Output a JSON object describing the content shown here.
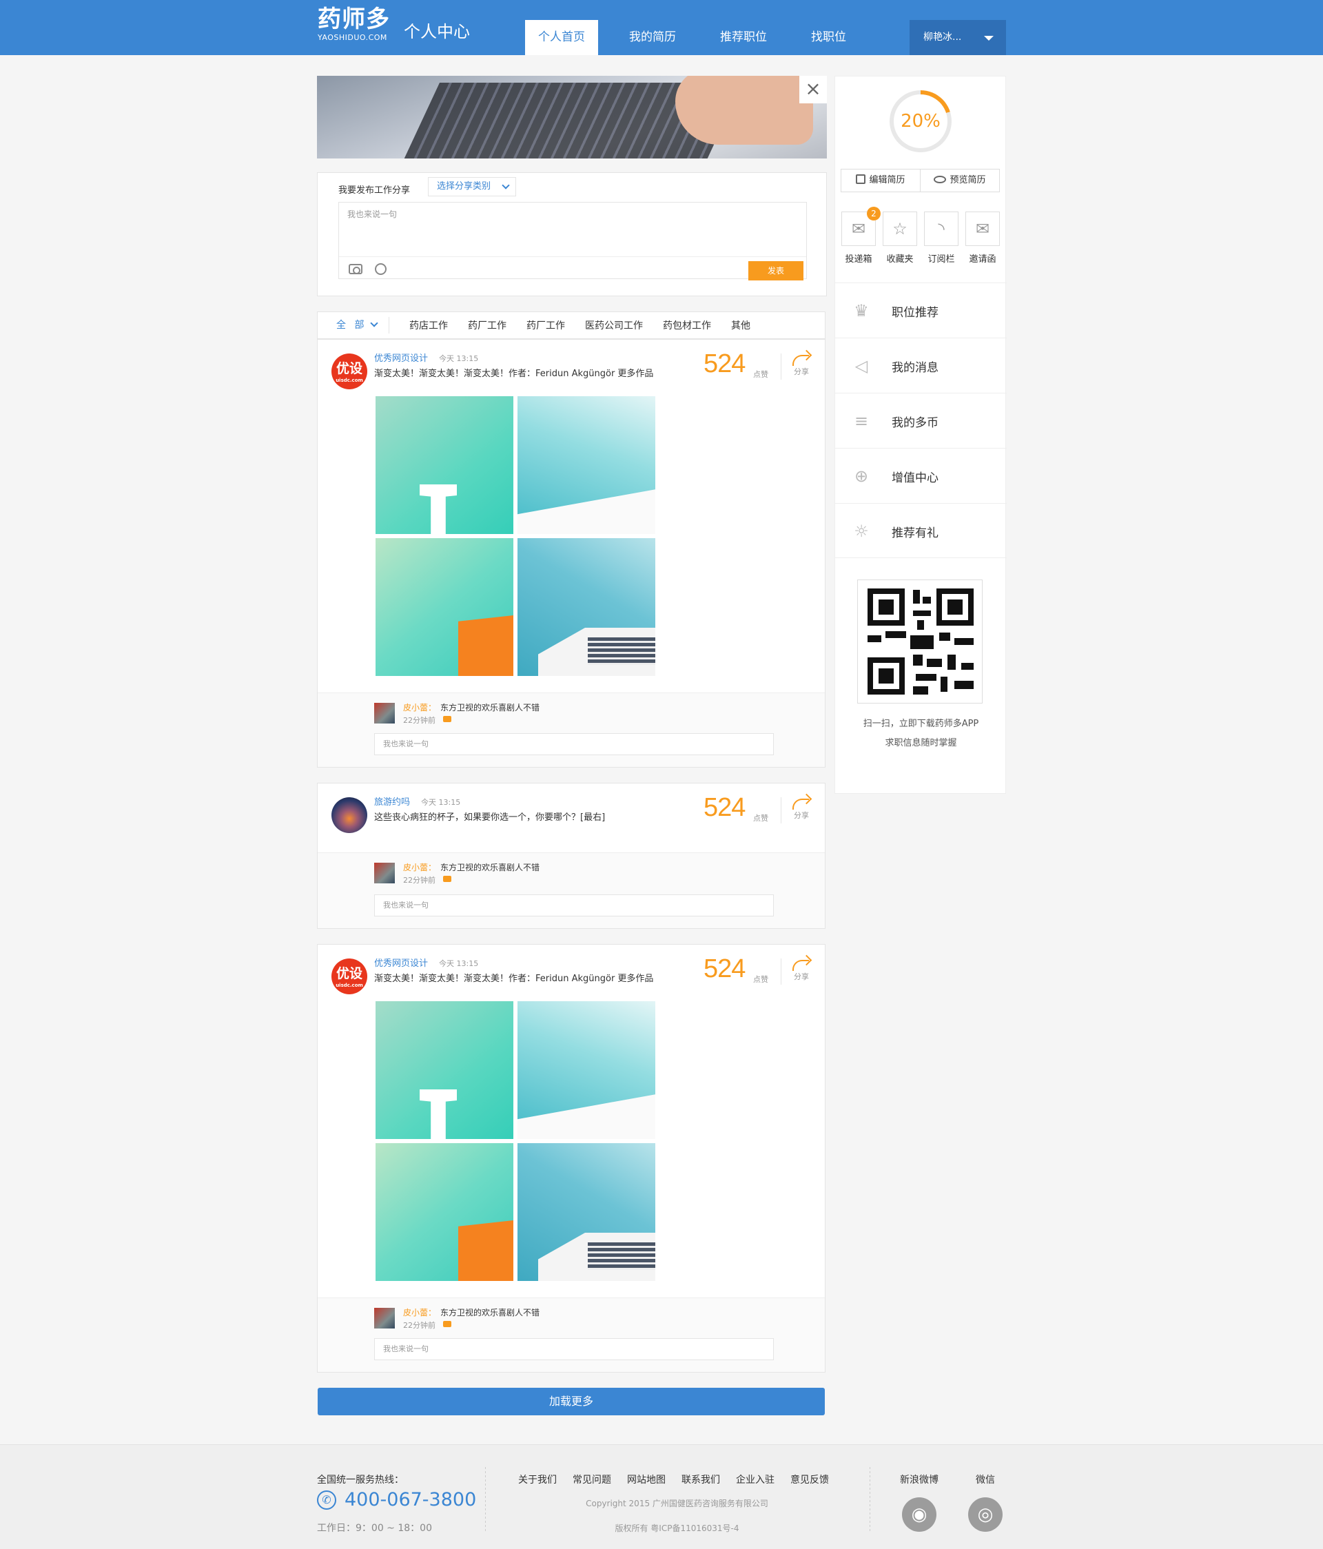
{
  "header": {
    "logo_main": "药师多",
    "logo_sub": "YAOSHIDUO.COM",
    "page_title": "个人中心",
    "nav": [
      "个人首页",
      "我的简历",
      "推荐职位",
      "找职位"
    ],
    "user": "柳艳冰..."
  },
  "publish": {
    "label": "我要发布工作分享",
    "category": "选择分享类别",
    "placeholder": "我也来说一句",
    "send": "发表"
  },
  "filter": {
    "all": "全 部",
    "categories": [
      "药店工作",
      "药厂工作",
      "药厂工作",
      "医药公司工作",
      "药包材工作",
      "其他"
    ]
  },
  "posts": [
    {
      "avatar": "优设",
      "avatar_sub": "uisdc.com",
      "user": "优秀网页设计",
      "time": "今天 13:15",
      "text": "渐变太美！渐变太美！渐变太美！作者：Feridun Akgüngör 更多作品",
      "likes": "524",
      "like_label": "点赞",
      "share": "分享"
    },
    {
      "user": "旅游约吗",
      "time": "今天 13:15",
      "text": "这些丧心病狂的杯子，如果要你选一个，你要哪个？[最右]",
      "likes": "524",
      "like_label": "点赞",
      "share": "分享"
    },
    {
      "avatar": "优设",
      "avatar_sub": "uisdc.com",
      "user": "优秀网页设计",
      "time": "今天 13:15",
      "text": "渐变太美！渐变太美！渐变太美！作者：Feridun Akgüngör 更多作品",
      "likes": "524",
      "like_label": "点赞",
      "share": "分享"
    }
  ],
  "comment": {
    "user": "皮小蕾：",
    "text": "东方卫视的欢乐喜剧人不错",
    "time": "22分钟前",
    "placeholder": "我也来说一句"
  },
  "load_more": "加载更多",
  "sidebar": {
    "progress": "20%",
    "edit": "编辑简历",
    "preview": "预览简历",
    "quick": [
      {
        "label": "投递箱",
        "badge": "2",
        "icon": "inbox-icon"
      },
      {
        "label": "收藏夹",
        "icon": "star-icon"
      },
      {
        "label": "订阅栏",
        "icon": "rss-icon"
      },
      {
        "label": "邀请函",
        "icon": "mail-icon"
      }
    ],
    "menu": [
      {
        "label": "职位推荐",
        "icon": "crown-icon"
      },
      {
        "label": "我的消息",
        "icon": "speaker-icon"
      },
      {
        "label": "我的多币",
        "icon": "coins-icon"
      },
      {
        "label": "增值中心",
        "icon": "plus-circle-icon"
      },
      {
        "label": "推荐有礼",
        "icon": "bulb-icon"
      }
    ],
    "qr_line1": "扫一扫，立即下载药师多APP",
    "qr_line2": "求职信息随时掌握"
  },
  "footer": {
    "hotline_label": "全国统一服务热线：",
    "phone": "400-067-3800",
    "hours": "工作日：9：00 ~ 18：00",
    "links": [
      "关于我们",
      "常见问题",
      "网站地图",
      "联系我们",
      "企业入驻",
      "意见反馈"
    ],
    "copyright": "Copyright 2015 广州国健医药咨询服务有限公司",
    "icp": "版权所有    粤ICP备11016031号-4",
    "weibo": "新浪微博",
    "wechat": "微信"
  },
  "colors": {
    "primary": "#3b86d3",
    "accent": "#f89b1e"
  }
}
